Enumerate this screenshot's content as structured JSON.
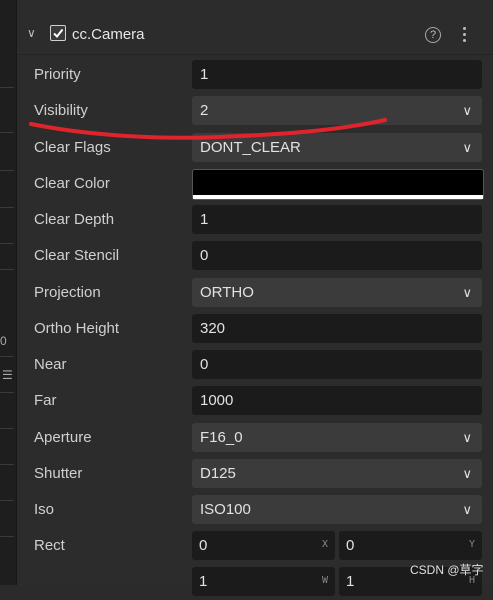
{
  "component": {
    "title": "cc.Camera",
    "enabled": true,
    "help_icon": "help-circle-icon",
    "menu_icon": "more-vert-icon"
  },
  "left_strip": {
    "glyph_zero": "0",
    "glyph_menu": "☰"
  },
  "properties": [
    {
      "label": "Priority",
      "value": "1",
      "kind": "input"
    },
    {
      "label": "Visibility",
      "value": "2",
      "kind": "select"
    },
    {
      "label": "Clear Flags",
      "value": "DONT_CLEAR",
      "kind": "select"
    },
    {
      "label": "Clear Color",
      "value": "#000000",
      "kind": "color"
    },
    {
      "label": "Clear Depth",
      "value": "1",
      "kind": "input"
    },
    {
      "label": "Clear Stencil",
      "value": "0",
      "kind": "input"
    },
    {
      "label": "Projection",
      "value": "ORTHO",
      "kind": "select"
    },
    {
      "label": "Ortho Height",
      "value": "320",
      "kind": "input"
    },
    {
      "label": "Near",
      "value": "0",
      "kind": "input"
    },
    {
      "label": "Far",
      "value": "1000",
      "kind": "input"
    },
    {
      "label": "Aperture",
      "value": "F16_0",
      "kind": "select"
    },
    {
      "label": "Shutter",
      "value": "D125",
      "kind": "select"
    },
    {
      "label": "Iso",
      "value": "ISO100",
      "kind": "select"
    }
  ],
  "rect": {
    "label": "Rect",
    "x": "0",
    "x_unit": "X",
    "y": "0",
    "y_unit": "Y",
    "w": "1",
    "w_unit": "W",
    "h": "1",
    "h_unit": "H"
  },
  "watermark": "CSDN @草字",
  "annotation_color": "#e0242b"
}
